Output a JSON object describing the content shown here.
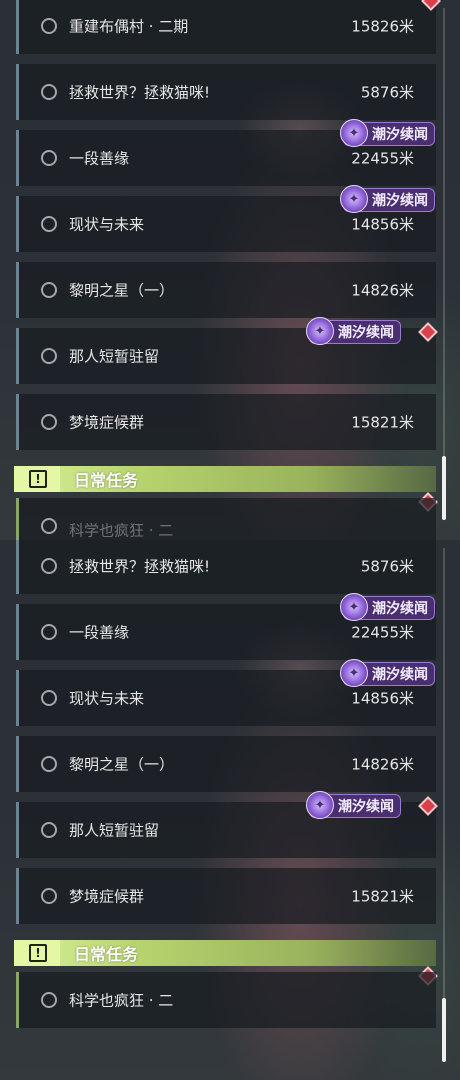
{
  "colors": {
    "row_accent": "#6a8494",
    "daily_accent": "#8aa56a",
    "tag_bg": "#4a2f70",
    "diamond": "#d9404c",
    "section_bg": "#b7d36e"
  },
  "panels": [
    {
      "quests": [
        {
          "title": "重建布偶村 · 二期",
          "distance": "15826米",
          "tag": ""
        },
        {
          "title": "拯救世界？拯救猫咪!",
          "distance": "5876米",
          "tag": ""
        },
        {
          "title": "一段善缘",
          "distance": "22455米",
          "tag": "潮汐续闻"
        },
        {
          "title": "现状与未来",
          "distance": "14856米",
          "tag": "潮汐续闻"
        },
        {
          "title": "黎明之星（一）",
          "distance": "14826米",
          "tag": ""
        },
        {
          "title": "那人短暂驻留",
          "distance": "",
          "tag": "潮汐续闻"
        },
        {
          "title": "梦境症候群",
          "distance": "15821米",
          "tag": ""
        }
      ],
      "section": {
        "title": "日常任务",
        "icon": "exclamation-icon"
      },
      "daily": [
        {
          "title": "科学也疯狂 · 二",
          "distance": ""
        }
      ]
    },
    {
      "quests": [
        {
          "title": "拯救世界？拯救猫咪!",
          "distance": "5876米",
          "tag": ""
        },
        {
          "title": "一段善缘",
          "distance": "22455米",
          "tag": "潮汐续闻"
        },
        {
          "title": "现状与未来",
          "distance": "14856米",
          "tag": "潮汐续闻"
        },
        {
          "title": "黎明之星（一）",
          "distance": "14826米",
          "tag": ""
        },
        {
          "title": "那人短暂驻留",
          "distance": "",
          "tag": "潮汐续闻"
        },
        {
          "title": "梦境症候群",
          "distance": "15821米",
          "tag": ""
        }
      ],
      "section": {
        "title": "日常任务",
        "icon": "exclamation-icon"
      },
      "daily": [
        {
          "title": "科学也疯狂 · 二",
          "distance": ""
        }
      ]
    }
  ],
  "icons": {
    "tag_icon": "tide-story-icon",
    "radio": "radio-circle-icon",
    "marker": "new-marker-diamond-icon"
  }
}
